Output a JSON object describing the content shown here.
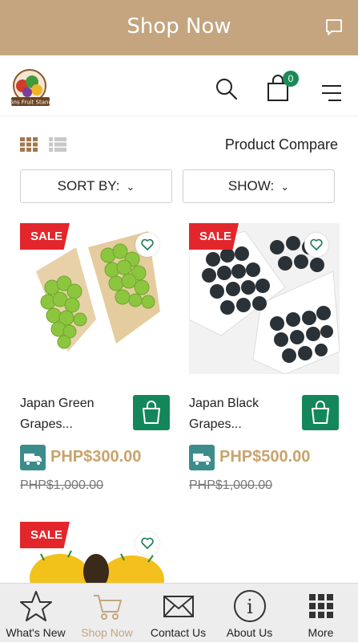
{
  "topbar": {
    "title": "Shop Now"
  },
  "header": {
    "cart_count": "0",
    "logo_text": "Gns Fruit Stand"
  },
  "toolbar": {
    "compare_label": "Product Compare"
  },
  "filters": {
    "sort_label": "SORT BY:",
    "show_label": "SHOW:"
  },
  "products": [
    {
      "badge": "SALE",
      "name": "Japan Green Grapes...",
      "price": "PHP$300.00",
      "old_price": "PHP$1,000.00"
    },
    {
      "badge": "SALE",
      "name": "Japan Black Grapes...",
      "price": "PHP$500.00",
      "old_price": "PHP$1,000.00"
    },
    {
      "badge": "SALE"
    }
  ],
  "nav": {
    "items": [
      {
        "label": "What's New"
      },
      {
        "label": "Shop Now",
        "active": true
      },
      {
        "label": "Contact Us"
      },
      {
        "label": "About Us"
      },
      {
        "label": "More"
      }
    ]
  },
  "colors": {
    "brand": "#c4a57f",
    "accent_green": "#14875a",
    "sale_red": "#e3262b",
    "price_gold": "#c9a36b"
  }
}
